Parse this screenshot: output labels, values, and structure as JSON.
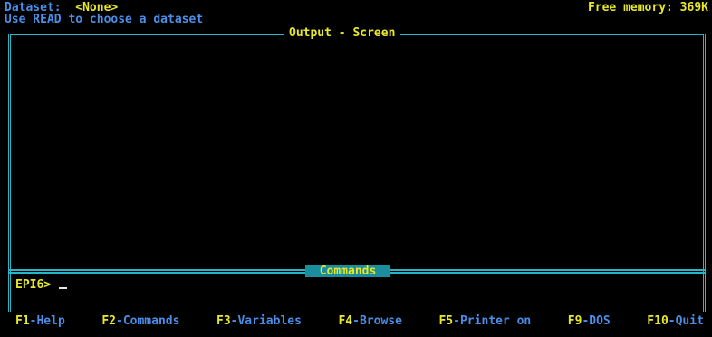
{
  "status": {
    "dataset_label": "Dataset:",
    "dataset_value": "<None>",
    "hint": "Use READ to choose a dataset",
    "memory": "Free memory: 369K"
  },
  "output": {
    "title": "Output - Screen"
  },
  "commands": {
    "label": "Commands",
    "prompt": "EPI6>"
  },
  "fkeys": [
    {
      "key": "F1",
      "label": "-Help"
    },
    {
      "key": "F2",
      "label": "-Commands"
    },
    {
      "key": "F3",
      "label": "-Variables"
    },
    {
      "key": "F4",
      "label": "-Browse"
    },
    {
      "key": "F5",
      "label": "-Printer on"
    },
    {
      "key": "F9",
      "label": "-DOS"
    },
    {
      "key": "F10",
      "label": "-Quit"
    }
  ],
  "colors": {
    "background": "#000000",
    "text_blue": "#4a8ee8",
    "text_yellow": "#e8e82a",
    "border_cyan": "#26b6c8",
    "label_teal": "#1a8e9c"
  }
}
